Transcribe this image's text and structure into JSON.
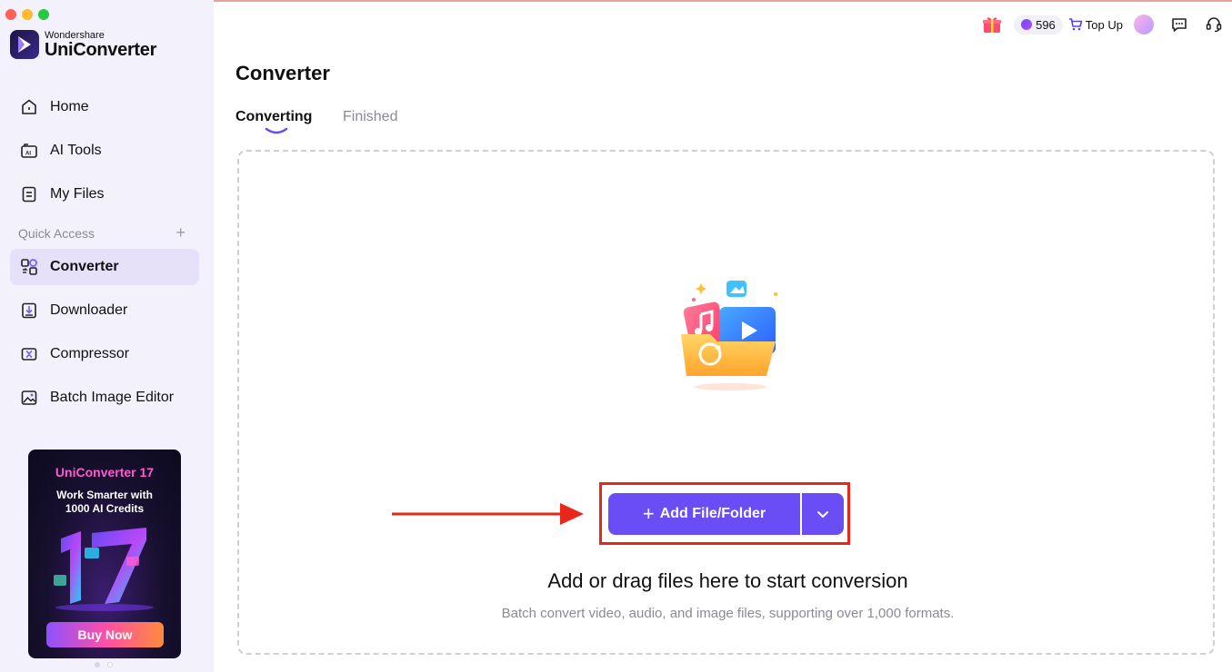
{
  "app": {
    "brand_small": "Wondershare",
    "brand_large": "UniConverter"
  },
  "sidebar": {
    "items": [
      {
        "label": "Home",
        "icon": "home-icon"
      },
      {
        "label": "AI Tools",
        "icon": "ai-tools-icon"
      },
      {
        "label": "My Files",
        "icon": "my-files-icon"
      }
    ],
    "quick_access_label": "Quick Access",
    "quick_items": [
      {
        "label": "Converter",
        "icon": "converter-icon",
        "active": true
      },
      {
        "label": "Downloader",
        "icon": "downloader-icon"
      },
      {
        "label": "Compressor",
        "icon": "compressor-icon"
      },
      {
        "label": "Batch Image Editor",
        "icon": "batch-image-editor-icon"
      }
    ]
  },
  "promo": {
    "title": "UniConverter 17",
    "subtitle_line1": "Work Smarter with",
    "subtitle_line2": "1000 AI Credits",
    "buy_label": "Buy Now"
  },
  "topbar": {
    "credits": "596",
    "top_up_label": "Top Up"
  },
  "main": {
    "title": "Converter",
    "tabs": [
      {
        "label": "Converting",
        "active": true
      },
      {
        "label": "Finished",
        "active": false
      }
    ],
    "dropzone": {
      "title": "Add or drag files here to start conversion",
      "subtitle": "Batch convert video, audio, and image files, supporting over 1,000 formats.",
      "add_button_label": "Add File/Folder"
    }
  },
  "colors": {
    "accent": "#6a4df5",
    "highlight": "#e8261a",
    "sidebar_bg": "#f3f1fb"
  }
}
